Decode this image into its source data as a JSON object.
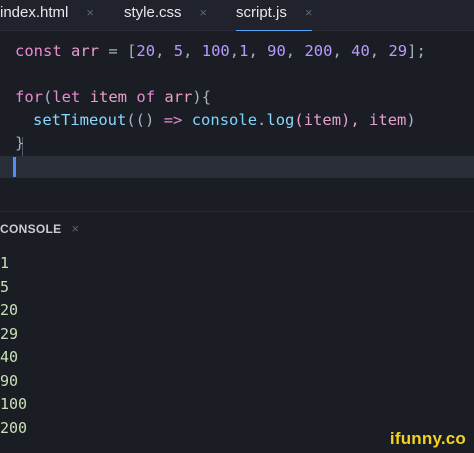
{
  "tabs": [
    {
      "label": "index.html",
      "close": "×"
    },
    {
      "label": "style.css",
      "close": "×"
    },
    {
      "label": "script.js",
      "close": "×"
    }
  ],
  "editor": {
    "line1": {
      "kw": "const",
      "name": "arr",
      "op": "=",
      "open": "[",
      "nums": [
        "20",
        "5",
        "100",
        "1",
        "90",
        "200",
        "40",
        "29"
      ],
      "close": "];"
    },
    "line2": {
      "kw1": "for",
      "open": "(",
      "kw2": "let",
      "item": "item",
      "kw3": "of",
      "arr": "arr",
      "close": "){"
    },
    "line3": {
      "fn": "setTimeout",
      "paren": "((",
      "close_paren": ")",
      "arrow": "=>",
      "obj": "console",
      "dot": ".",
      "method": "log",
      "arg": "(item),",
      "item2": "item",
      "end": ")"
    },
    "line4": {
      "text": "}"
    }
  },
  "console": {
    "title": "CONSOLE",
    "close": "×",
    "output": [
      "1",
      "5",
      "20",
      "29",
      "40",
      "90",
      "100",
      "200"
    ]
  },
  "watermark": "ifunny.co"
}
